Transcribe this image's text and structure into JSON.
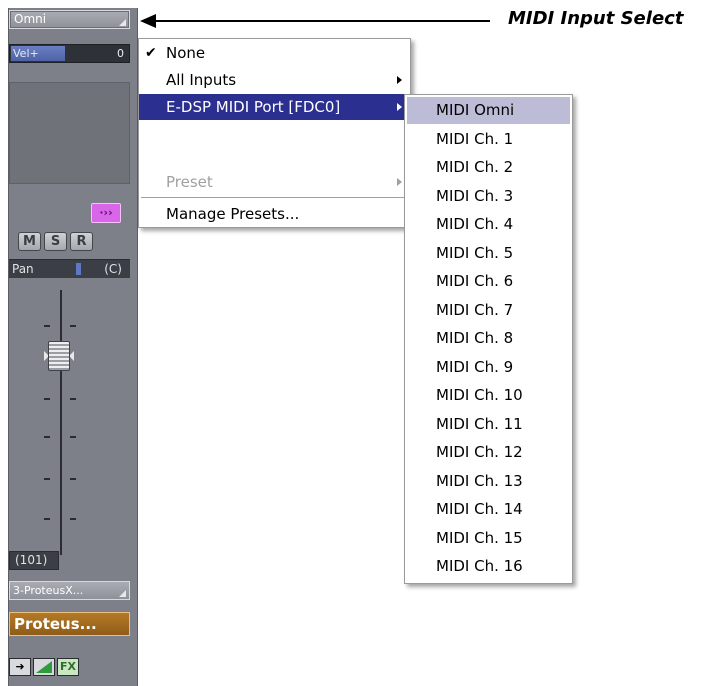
{
  "strip": {
    "input_select": "Omni",
    "vel_label": "Vel+",
    "vel_value": "0",
    "vel_level_fraction": 0.45,
    "monitor_icon": "monitor-arrow-icon",
    "mute": "M",
    "solo": "S",
    "record": "R",
    "pan_label": "Pan",
    "pan_value": "(C)",
    "volume_value": "(101)",
    "output_select": "3-ProteusX...",
    "channel_name": "Proteus...",
    "colors": {
      "accent_monitor": "#d966e8",
      "name_bg": "#a86e20",
      "vel_fill": "#5e72b8"
    }
  },
  "menu": {
    "items": [
      {
        "label": "None",
        "checked": true
      },
      {
        "label": "All Inputs",
        "submenu": true
      },
      {
        "label": "E-DSP MIDI Port [FDC0]",
        "submenu": true,
        "highlighted": true
      },
      {
        "label": "Preset",
        "submenu": true,
        "disabled": true
      },
      {
        "label": "Manage Presets..."
      }
    ]
  },
  "submenu": {
    "items": [
      "MIDI Omni",
      "MIDI Ch. 1",
      "MIDI Ch. 2",
      "MIDI Ch. 3",
      "MIDI Ch. 4",
      "MIDI Ch. 5",
      "MIDI Ch. 6",
      "MIDI Ch. 7",
      "MIDI Ch. 8",
      "MIDI Ch. 9",
      "MIDI Ch. 10",
      "MIDI Ch. 11",
      "MIDI Ch. 12",
      "MIDI Ch. 13",
      "MIDI Ch. 14",
      "MIDI Ch. 15",
      "MIDI Ch. 16"
    ],
    "highlighted": "MIDI Omni"
  },
  "annotation": {
    "label": "MIDI Input Select"
  }
}
